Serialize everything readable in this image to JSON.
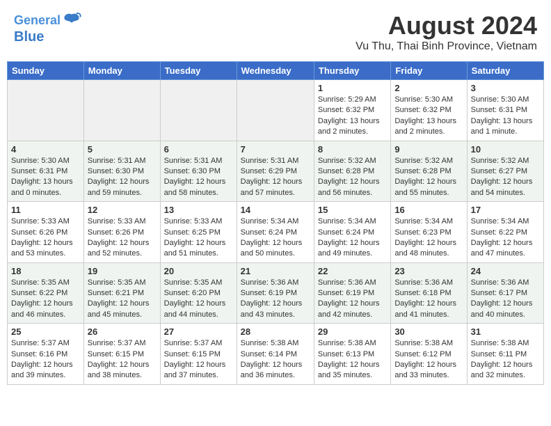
{
  "header": {
    "logo_line1": "General",
    "logo_line2": "Blue",
    "title": "August 2024",
    "subtitle": "Vu Thu, Thai Binh Province, Vietnam"
  },
  "calendar": {
    "days_of_week": [
      "Sunday",
      "Monday",
      "Tuesday",
      "Wednesday",
      "Thursday",
      "Friday",
      "Saturday"
    ],
    "weeks": [
      [
        {
          "day": "",
          "info": ""
        },
        {
          "day": "",
          "info": ""
        },
        {
          "day": "",
          "info": ""
        },
        {
          "day": "",
          "info": ""
        },
        {
          "day": "1",
          "info": "Sunrise: 5:29 AM\nSunset: 6:32 PM\nDaylight: 13 hours\nand 2 minutes."
        },
        {
          "day": "2",
          "info": "Sunrise: 5:30 AM\nSunset: 6:32 PM\nDaylight: 13 hours\nand 2 minutes."
        },
        {
          "day": "3",
          "info": "Sunrise: 5:30 AM\nSunset: 6:31 PM\nDaylight: 13 hours\nand 1 minute."
        }
      ],
      [
        {
          "day": "4",
          "info": "Sunrise: 5:30 AM\nSunset: 6:31 PM\nDaylight: 13 hours\nand 0 minutes."
        },
        {
          "day": "5",
          "info": "Sunrise: 5:31 AM\nSunset: 6:30 PM\nDaylight: 12 hours\nand 59 minutes."
        },
        {
          "day": "6",
          "info": "Sunrise: 5:31 AM\nSunset: 6:30 PM\nDaylight: 12 hours\nand 58 minutes."
        },
        {
          "day": "7",
          "info": "Sunrise: 5:31 AM\nSunset: 6:29 PM\nDaylight: 12 hours\nand 57 minutes."
        },
        {
          "day": "8",
          "info": "Sunrise: 5:32 AM\nSunset: 6:28 PM\nDaylight: 12 hours\nand 56 minutes."
        },
        {
          "day": "9",
          "info": "Sunrise: 5:32 AM\nSunset: 6:28 PM\nDaylight: 12 hours\nand 55 minutes."
        },
        {
          "day": "10",
          "info": "Sunrise: 5:32 AM\nSunset: 6:27 PM\nDaylight: 12 hours\nand 54 minutes."
        }
      ],
      [
        {
          "day": "11",
          "info": "Sunrise: 5:33 AM\nSunset: 6:26 PM\nDaylight: 12 hours\nand 53 minutes."
        },
        {
          "day": "12",
          "info": "Sunrise: 5:33 AM\nSunset: 6:26 PM\nDaylight: 12 hours\nand 52 minutes."
        },
        {
          "day": "13",
          "info": "Sunrise: 5:33 AM\nSunset: 6:25 PM\nDaylight: 12 hours\nand 51 minutes."
        },
        {
          "day": "14",
          "info": "Sunrise: 5:34 AM\nSunset: 6:24 PM\nDaylight: 12 hours\nand 50 minutes."
        },
        {
          "day": "15",
          "info": "Sunrise: 5:34 AM\nSunset: 6:24 PM\nDaylight: 12 hours\nand 49 minutes."
        },
        {
          "day": "16",
          "info": "Sunrise: 5:34 AM\nSunset: 6:23 PM\nDaylight: 12 hours\nand 48 minutes."
        },
        {
          "day": "17",
          "info": "Sunrise: 5:34 AM\nSunset: 6:22 PM\nDaylight: 12 hours\nand 47 minutes."
        }
      ],
      [
        {
          "day": "18",
          "info": "Sunrise: 5:35 AM\nSunset: 6:22 PM\nDaylight: 12 hours\nand 46 minutes."
        },
        {
          "day": "19",
          "info": "Sunrise: 5:35 AM\nSunset: 6:21 PM\nDaylight: 12 hours\nand 45 minutes."
        },
        {
          "day": "20",
          "info": "Sunrise: 5:35 AM\nSunset: 6:20 PM\nDaylight: 12 hours\nand 44 minutes."
        },
        {
          "day": "21",
          "info": "Sunrise: 5:36 AM\nSunset: 6:19 PM\nDaylight: 12 hours\nand 43 minutes."
        },
        {
          "day": "22",
          "info": "Sunrise: 5:36 AM\nSunset: 6:19 PM\nDaylight: 12 hours\nand 42 minutes."
        },
        {
          "day": "23",
          "info": "Sunrise: 5:36 AM\nSunset: 6:18 PM\nDaylight: 12 hours\nand 41 minutes."
        },
        {
          "day": "24",
          "info": "Sunrise: 5:36 AM\nSunset: 6:17 PM\nDaylight: 12 hours\nand 40 minutes."
        }
      ],
      [
        {
          "day": "25",
          "info": "Sunrise: 5:37 AM\nSunset: 6:16 PM\nDaylight: 12 hours\nand 39 minutes."
        },
        {
          "day": "26",
          "info": "Sunrise: 5:37 AM\nSunset: 6:15 PM\nDaylight: 12 hours\nand 38 minutes."
        },
        {
          "day": "27",
          "info": "Sunrise: 5:37 AM\nSunset: 6:15 PM\nDaylight: 12 hours\nand 37 minutes."
        },
        {
          "day": "28",
          "info": "Sunrise: 5:38 AM\nSunset: 6:14 PM\nDaylight: 12 hours\nand 36 minutes."
        },
        {
          "day": "29",
          "info": "Sunrise: 5:38 AM\nSunset: 6:13 PM\nDaylight: 12 hours\nand 35 minutes."
        },
        {
          "day": "30",
          "info": "Sunrise: 5:38 AM\nSunset: 6:12 PM\nDaylight: 12 hours\nand 33 minutes."
        },
        {
          "day": "31",
          "info": "Sunrise: 5:38 AM\nSunset: 6:11 PM\nDaylight: 12 hours\nand 32 minutes."
        }
      ]
    ]
  }
}
